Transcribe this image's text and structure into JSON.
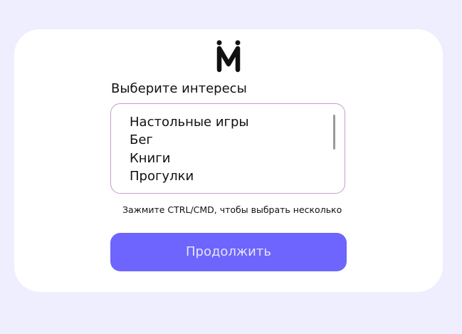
{
  "logo": {
    "icon": "m-letter-logo-icon"
  },
  "form": {
    "heading": "Выберите интересы",
    "options": [
      "Настольные игры",
      "Бег",
      "Книги",
      "Прогулки"
    ],
    "hint": "Зажмите CTRL/CMD, чтобы выбрать несколько",
    "continue_label": "Продолжить"
  },
  "colors": {
    "page_background": "#efeefe",
    "card_background": "#ffffff",
    "listbox_border": "#c79ad0",
    "button_background": "#6d65fd",
    "button_text": "#e6e4ff"
  }
}
